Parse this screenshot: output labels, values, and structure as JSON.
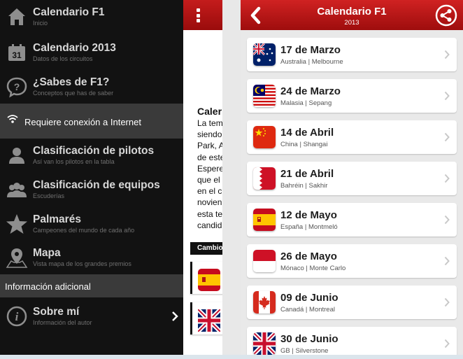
{
  "drawer": {
    "items": [
      {
        "title": "Calendario F1",
        "subtitle": "Inicio",
        "icon": "home-icon"
      },
      {
        "title": "Calendario 2013",
        "subtitle": "Datos de los circuitos",
        "icon": "calendar-31-icon",
        "icon_text": "31"
      },
      {
        "title": "¿Sabes de F1?",
        "subtitle": "Conceptos que has de saber",
        "icon": "question-bubble-icon"
      },
      {
        "title": "Clasificación de pilotos",
        "subtitle": "Así van los pilotos en la tabla",
        "icon": "person-icon"
      },
      {
        "title": "Clasificación de equipos",
        "subtitle": "Escuderías",
        "icon": "group-icon"
      },
      {
        "title": "Palmarés",
        "subtitle": "Campeones del mundo de cada año",
        "icon": "star-icon"
      },
      {
        "title": "Mapa",
        "subtitle": "Vista mapa de los grandes premios",
        "icon": "map-pin-icon"
      },
      {
        "title": "Sobre mí",
        "subtitle": "Información del autor",
        "icon": "info-icon"
      }
    ],
    "notice": "Requiere conexión a Internet",
    "section_label": "Información adicional"
  },
  "middle": {
    "lines": [
      "Caler",
      "La tem",
      "siendo",
      "Park, A",
      "de este",
      "Espere",
      "que el",
      "en el c",
      "novien",
      "esta te",
      "candid"
    ],
    "band_label": "Cambio"
  },
  "calendar": {
    "title": "Calendario F1",
    "year": "2013",
    "races": [
      {
        "date": "17 de Marzo",
        "place": "Australia | Melbourne",
        "flag": "australia"
      },
      {
        "date": "24 de Marzo",
        "place": "Malasia | Sepang",
        "flag": "malaysia"
      },
      {
        "date": "14 de Abril",
        "place": "China | Shangai",
        "flag": "china"
      },
      {
        "date": "21 de Abril",
        "place": "Bahréin | Sakhir",
        "flag": "bahrain"
      },
      {
        "date": "12 de Mayo",
        "place": "España | Montmeló",
        "flag": "spain"
      },
      {
        "date": "26 de Mayo",
        "place": "Mónaco | Monte Carlo",
        "flag": "monaco"
      },
      {
        "date": "09 de Junio",
        "place": "Canadá | Montreal",
        "flag": "canada"
      },
      {
        "date": "30 de Junio",
        "place": "GB | Silverstone",
        "flag": "uk"
      }
    ]
  },
  "colors": {
    "header_red": "#b31616",
    "drawer_bg": "#121212",
    "band_gray": "#3a3a3a"
  }
}
